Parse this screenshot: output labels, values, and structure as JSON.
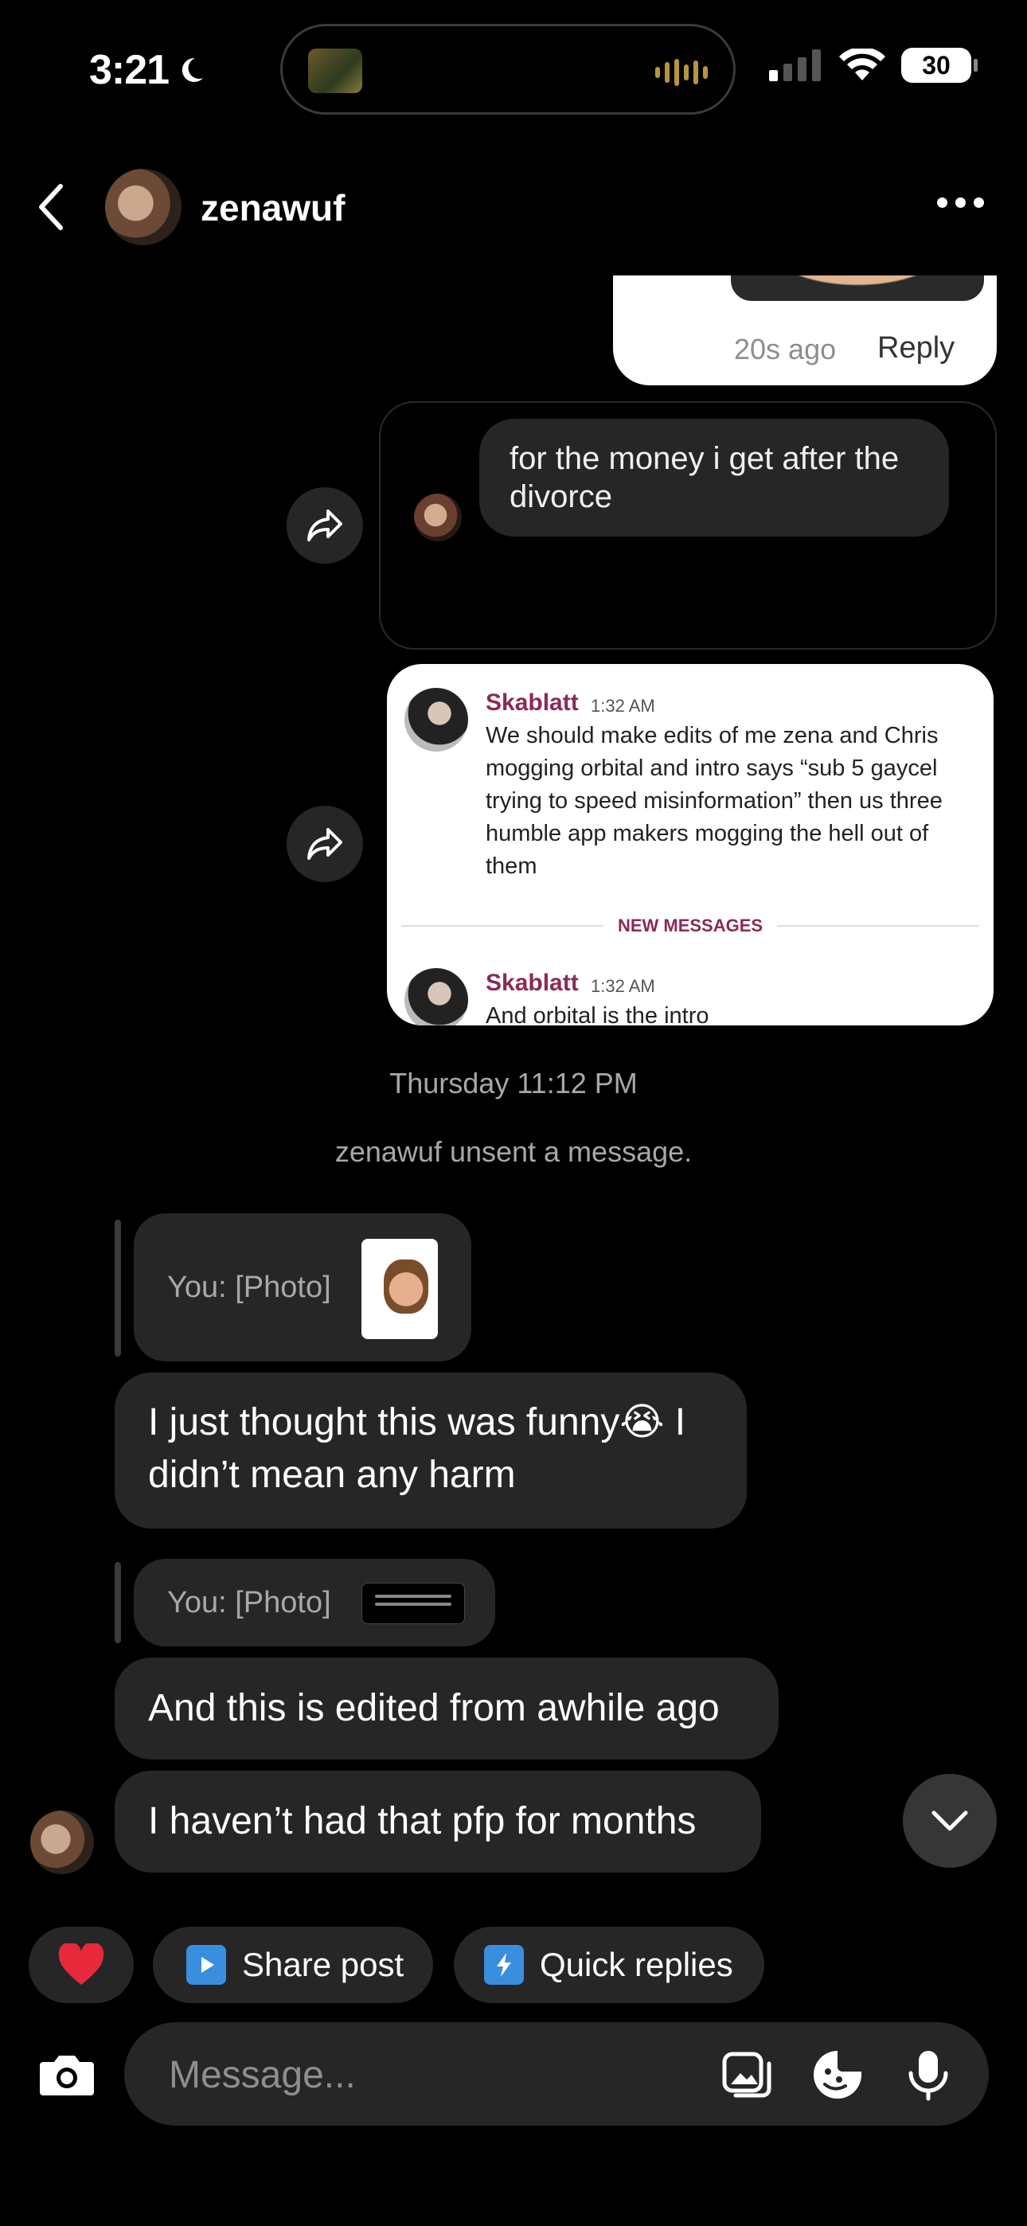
{
  "status_bar": {
    "time": "3:21",
    "battery": "30"
  },
  "header": {
    "username": "zenawuf"
  },
  "shared_post": {
    "ago": "20s ago",
    "reply": "Reply"
  },
  "reshared_message": {
    "text": "for the money i get after the divorce"
  },
  "discord_screenshot": {
    "msg1": {
      "name": "Skablatt",
      "time": "1:32 AM",
      "text": "We should make edits of me zena and Chris mogging orbital and intro says “sub 5 gaycel trying to speed misinformation” then us three humble app makers mogging the hell out of them"
    },
    "divider": "NEW MESSAGES",
    "msg2": {
      "name": "Skablatt",
      "time": "1:32 AM",
      "text": "And orbital  is the intro"
    }
  },
  "timestamp": "Thursday 11:12 PM",
  "system_message": "zenawuf unsent a message.",
  "incoming": {
    "reply_quote_1": "You: [Photo]",
    "message_1": "I just thought this was funny😭 I didn’t mean any harm",
    "reply_quote_2": "You: [Photo]",
    "message_2": "And this is edited from awhile ago",
    "message_3": "I haven’t had that pfp for months"
  },
  "quick_actions": {
    "share_post": "Share post",
    "quick_replies": "Quick replies"
  },
  "composer": {
    "placeholder": "Message..."
  },
  "colors": {
    "accent_blue": "#3a8ee0",
    "heart_red": "#e8293c",
    "bubble": "#262626"
  },
  "icons": [
    "back-icon",
    "more-icon",
    "forward-icon",
    "heart-icon",
    "share-post-icon",
    "quick-replies-icon",
    "camera-icon",
    "gallery-icon",
    "sticker-icon",
    "microphone-icon",
    "chevron-down-icon"
  ]
}
